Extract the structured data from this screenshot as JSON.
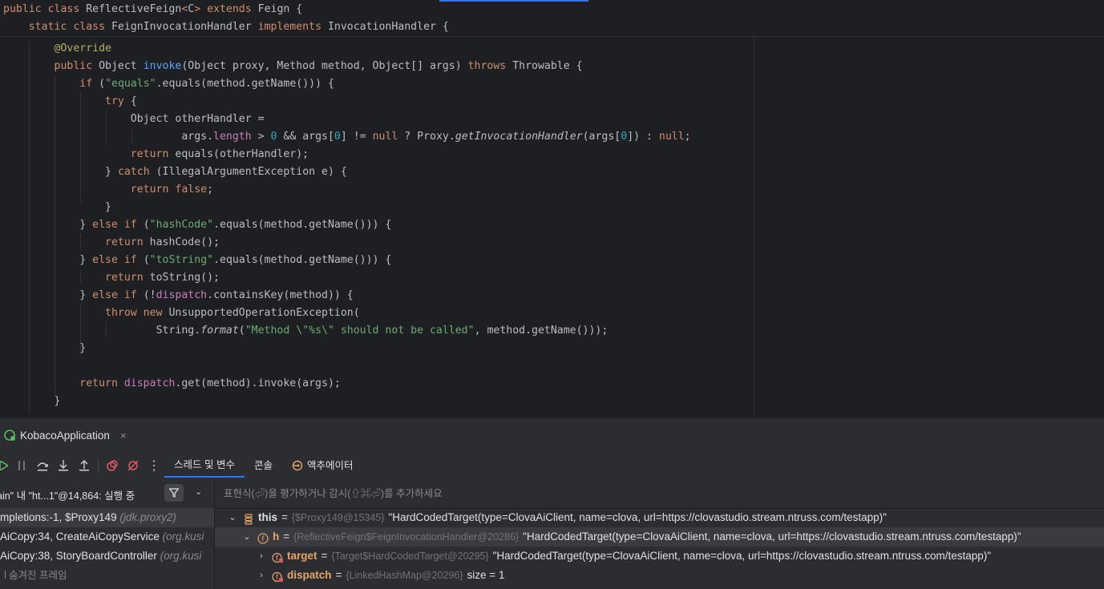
{
  "sticky_lines": [
    {
      "indent": "",
      "tokens": [
        [
          "kw",
          "public class "
        ],
        [
          "",
          "ReflectiveFeign"
        ],
        [
          "kw",
          "<"
        ],
        [
          "",
          "C"
        ],
        [
          "kw",
          "> "
        ],
        [
          "kw",
          "extends "
        ],
        [
          "",
          "Feign {"
        ]
      ]
    },
    {
      "indent": "    ",
      "tokens": [
        [
          "kw",
          "static class "
        ],
        [
          "",
          "FeignInvocationHandler "
        ],
        [
          "kw",
          "implements "
        ],
        [
          "",
          "InvocationHandler {"
        ]
      ]
    }
  ],
  "code_lines": [
    {
      "indent": "        ",
      "tokens": [
        [
          "ann",
          "@Override"
        ]
      ]
    },
    {
      "indent": "        ",
      "tokens": [
        [
          "kw",
          "public "
        ],
        [
          "",
          "Object "
        ],
        [
          "fn",
          "invoke"
        ],
        [
          "",
          "(Object proxy, Method method, Object[] args) "
        ],
        [
          "kw",
          "throws "
        ],
        [
          "",
          "Throwable {"
        ]
      ]
    },
    {
      "indent": "            ",
      "tokens": [
        [
          "kw",
          "if "
        ],
        [
          "",
          "("
        ],
        [
          "str",
          "\"equals\""
        ],
        [
          "",
          ".equals(method.getName())) {"
        ]
      ]
    },
    {
      "indent": "                ",
      "tokens": [
        [
          "kw",
          "try "
        ],
        [
          "",
          "{"
        ]
      ]
    },
    {
      "indent": "                    ",
      "tokens": [
        [
          "",
          "Object otherHandler ="
        ]
      ]
    },
    {
      "indent": "                            ",
      "tokens": [
        [
          "",
          "args."
        ],
        [
          "fld",
          "length"
        ],
        [
          "",
          " > "
        ],
        [
          "num",
          "0"
        ],
        [
          "",
          " && args["
        ],
        [
          "num",
          "0"
        ],
        [
          "",
          "] != "
        ],
        [
          "kw",
          "null"
        ],
        [
          "",
          " ? Proxy."
        ],
        [
          "it",
          "getInvocationHandler"
        ],
        [
          "",
          "(args["
        ],
        [
          "num",
          "0"
        ],
        [
          "",
          "]) : "
        ],
        [
          "kw",
          "null"
        ],
        [
          "",
          ";"
        ]
      ]
    },
    {
      "indent": "                    ",
      "tokens": [
        [
          "kw",
          "return "
        ],
        [
          "",
          "equals(otherHandler);"
        ]
      ]
    },
    {
      "indent": "                ",
      "tokens": [
        [
          "",
          "} "
        ],
        [
          "kw",
          "catch "
        ],
        [
          "",
          "(IllegalArgumentException e) {"
        ]
      ]
    },
    {
      "indent": "                    ",
      "tokens": [
        [
          "kw",
          "return false"
        ],
        [
          "",
          ";"
        ]
      ]
    },
    {
      "indent": "                ",
      "tokens": [
        [
          "",
          "}"
        ]
      ]
    },
    {
      "indent": "            ",
      "tokens": [
        [
          "",
          "} "
        ],
        [
          "kw",
          "else if "
        ],
        [
          "",
          "("
        ],
        [
          "str",
          "\"hashCode\""
        ],
        [
          "",
          ".equals(method.getName())) {"
        ]
      ]
    },
    {
      "indent": "                ",
      "tokens": [
        [
          "kw",
          "return "
        ],
        [
          "",
          "hashCode();"
        ]
      ]
    },
    {
      "indent": "            ",
      "tokens": [
        [
          "",
          "} "
        ],
        [
          "kw",
          "else if "
        ],
        [
          "",
          "("
        ],
        [
          "str",
          "\"toString\""
        ],
        [
          "",
          ".equals(method.getName())) {"
        ]
      ]
    },
    {
      "indent": "                ",
      "tokens": [
        [
          "kw",
          "return "
        ],
        [
          "",
          "toString();"
        ]
      ]
    },
    {
      "indent": "            ",
      "tokens": [
        [
          "",
          "} "
        ],
        [
          "kw",
          "else if "
        ],
        [
          "",
          "(!"
        ],
        [
          "fld",
          "dispatch"
        ],
        [
          "",
          ".containsKey(method)) {"
        ]
      ]
    },
    {
      "indent": "                ",
      "tokens": [
        [
          "kw",
          "throw new "
        ],
        [
          "",
          "UnsupportedOperationException("
        ]
      ]
    },
    {
      "indent": "                        ",
      "tokens": [
        [
          "",
          "String."
        ],
        [
          "it",
          "format"
        ],
        [
          "",
          "("
        ],
        [
          "str",
          "\"Method \\\"%s\\\" should not be called\""
        ],
        [
          "",
          ", method.getName()));"
        ]
      ]
    },
    {
      "indent": "            ",
      "tokens": [
        [
          "",
          "}"
        ]
      ]
    },
    {
      "indent": "",
      "tokens": []
    },
    {
      "indent": "            ",
      "tokens": [
        [
          "kw",
          "return "
        ],
        [
          "fld",
          "dispatch"
        ],
        [
          "",
          ".get(method).invoke(args);"
        ]
      ]
    },
    {
      "indent": "        ",
      "tokens": [
        [
          "",
          "}"
        ]
      ]
    }
  ],
  "run_tab": {
    "label": "KobacoApplication",
    "close": "×"
  },
  "debug_tabs": [
    {
      "label": "스레드 및 변수",
      "active": true
    },
    {
      "label": "콘솔",
      "active": false
    },
    {
      "label": "액추에이터",
      "active": false
    }
  ],
  "thread_selector": {
    "text": "ain\" 내 \"ht...1\"@14,864: 실행 중"
  },
  "frames": [
    {
      "method": "mpletions:-1, $Proxy149 ",
      "pkg": "(jdk.proxy2)",
      "selected": true
    },
    {
      "method": "AiCopy:34, CreateAiCopyService ",
      "pkg": "(org.kusi",
      "selected": false
    },
    {
      "method": "AiCopy:38, StoryBoardController ",
      "pkg": "(org.kusi",
      "selected": false
    }
  ],
  "hidden_frames": "숨겨진 프레임",
  "eval_placeholder": "표현식(⏎)을 평가하거나 감시(⇧⌘⏎)를 추가하세요",
  "variables": [
    {
      "arrow": "⌄",
      "indent": 15,
      "icon": "stack",
      "name": "this",
      "ref": "{$Proxy149@15345}",
      "value": "\"HardCodedTarget(type=ClovaAiClient, name=clova, url=https://clovastudio.stream.ntruss.com/testapp)\"",
      "selected": false,
      "orange": false
    },
    {
      "arrow": "⌄",
      "indent": 33,
      "icon": "field-final",
      "name": "h",
      "ref": "{ReflectiveFeign$FeignInvocationHandler@20286}",
      "value": "\"HardCodedTarget(type=ClovaAiClient, name=clova, url=https://clovastudio.stream.ntruss.com/testapp)\"",
      "selected": true,
      "orange": true
    },
    {
      "arrow": "›",
      "indent": 51,
      "icon": "field-locked",
      "name": "target",
      "ref": "{Target$HardCodedTarget@20295}",
      "value": "\"HardCodedTarget(type=ClovaAiClient, name=clova, url=https://clovastudio.stream.ntruss.com/testapp)\"",
      "selected": false,
      "orange": true
    },
    {
      "arrow": "›",
      "indent": 51,
      "icon": "field-locked",
      "name": "dispatch",
      "ref": "{LinkedHashMap@20296}",
      "value": "size = 1",
      "selected": false,
      "orange": true
    }
  ],
  "colors": {
    "keyword": "#cf8e6d",
    "string": "#6aab73",
    "number": "#2aacb8",
    "function": "#56a8f5",
    "field": "#c77dbb",
    "annotation": "#b3ae60",
    "accent": "#3574f0"
  }
}
